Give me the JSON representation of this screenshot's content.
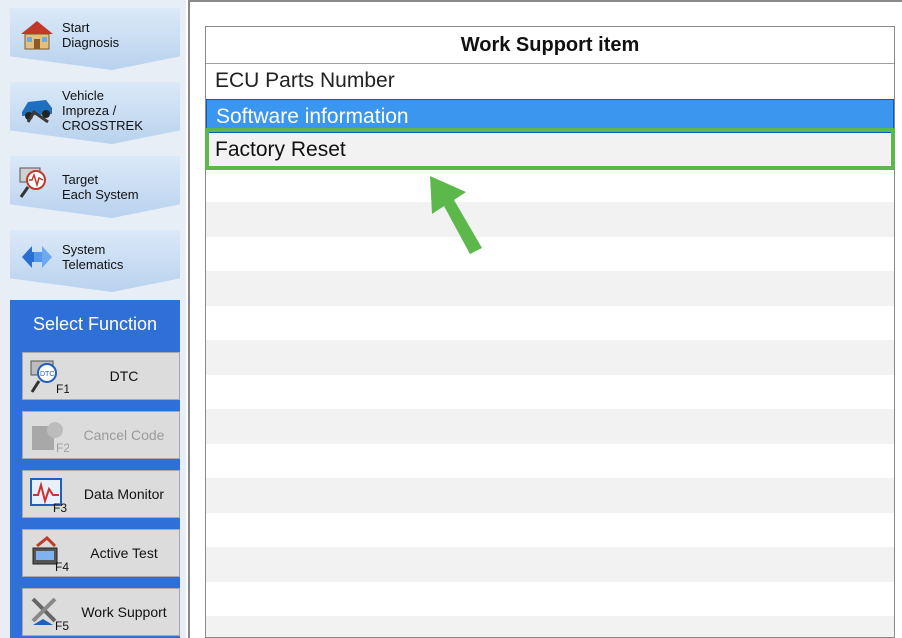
{
  "nav": {
    "start": {
      "line1": "Start",
      "line2": "Diagnosis",
      "icon": "house-icon"
    },
    "vehicle": {
      "line1": "Vehicle",
      "line2": "Impreza /",
      "line3": "CROSSTREK",
      "icon": "car-icon"
    },
    "target": {
      "line1": "Target",
      "line2": "Each System",
      "icon": "ecu-scope-icon"
    },
    "system": {
      "line1": "System",
      "line2": "Telematics",
      "icon": "telematics-icon"
    }
  },
  "select_function": {
    "title": "Select Function",
    "buttons": [
      {
        "label": "DTC",
        "icon": "dtc-f1-icon",
        "enabled": true
      },
      {
        "label": "Cancel Code",
        "icon": "cancel-code-f2-icon",
        "enabled": false
      },
      {
        "label": "Data Monitor",
        "icon": "data-monitor-f3-icon",
        "enabled": true
      },
      {
        "label": "Active Test",
        "icon": "active-test-f4-icon",
        "enabled": true
      },
      {
        "label": "Work Support",
        "icon": "work-support-f5-icon",
        "enabled": true
      }
    ]
  },
  "table": {
    "header": "Work Support item",
    "rows": [
      "ECU Parts Number",
      "Software information",
      "Factory Reset"
    ],
    "selected_index": 1,
    "highlighted_index": 2
  },
  "colors": {
    "selection": "#3a96ee",
    "highlight": "#5cb84a",
    "panel": "#2f6fd8"
  }
}
